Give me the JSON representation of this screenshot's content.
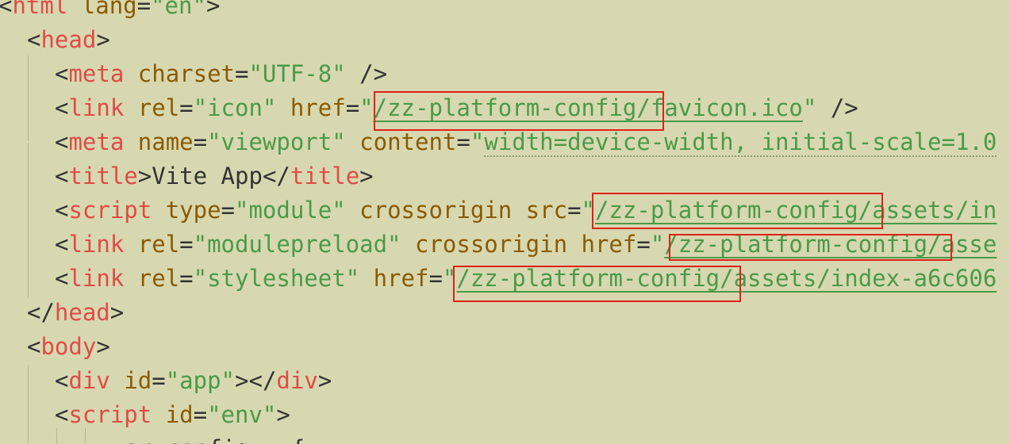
{
  "code": {
    "l0": {
      "lt": "<",
      "tag": "html",
      "a1": " lang",
      "eq": "=",
      "v1": "\"en\"",
      "gt": ">"
    },
    "l1": {
      "lt": "<",
      "tag": "head",
      "gt": ">"
    },
    "l2": {
      "lt": "<",
      "tag": "meta",
      "a1": " charset",
      "eq": "=",
      "v1": "\"UTF-8\"",
      "end": " />"
    },
    "l3": {
      "lt": "<",
      "tag": "link",
      "a1": " rel",
      "eq1": "=",
      "v1": "\"icon\"",
      "a2": " href",
      "eq2": "=",
      "q": "\"",
      "v2": "/zz-platform-config/favicon.ico",
      "q2": "\"",
      "end": " />"
    },
    "l4": {
      "lt": "<",
      "tag": "meta",
      "a1": " name",
      "eq1": "=",
      "v1": "\"viewport\"",
      "a2": " content",
      "eq2": "=",
      "q": "\"",
      "v2": "width=device-width, initial-scale=1.0"
    },
    "l5": {
      "lt": "<",
      "tag": "title",
      "gt": ">",
      "text": "Vite App",
      "clt": "</",
      "ctag": "title",
      "cgt": ">"
    },
    "l6": {
      "lt": "<",
      "tag": "script",
      "a1": " type",
      "eq1": "=",
      "v1": "\"module\"",
      "a2": " crossorigin",
      "a3": " src",
      "eq3": "=",
      "q": "\"",
      "v3": "/zz-platform-config/assets/in"
    },
    "l7": {
      "lt": "<",
      "tag": "link",
      "a1": " rel",
      "eq1": "=",
      "v1": "\"modulepreload\"",
      "a2": " crossorigin",
      "a3": " href",
      "eq3": "=",
      "q": "\"",
      "v3": "/zz-platform-config/asse"
    },
    "l8": {
      "lt": "<",
      "tag": "link",
      "a1": " rel",
      "eq1": "=",
      "v1": "\"stylesheet\"",
      "a2": " href",
      "eq2": "=",
      "q": "\"",
      "v2": "/zz-platform-config/assets/index-a6c606"
    },
    "l9": {
      "lt": "</",
      "tag": "head",
      "gt": ">"
    },
    "l10": {
      "lt": "<",
      "tag": "body",
      "gt": ">"
    },
    "l11": {
      "lt": "<",
      "tag": "div",
      "a1": " id",
      "eq": "=",
      "v1": "\"app\"",
      "gt": ">",
      "clt": "</",
      "ctag": "div",
      "cgt": ">"
    },
    "l12": {
      "lt": "<",
      "tag": "script",
      "a1": " id",
      "eq": "=",
      "v1": "\"env\"",
      "gt": ">"
    },
    "l13": {
      "text": "var config = {"
    }
  },
  "colors": {
    "background": "#d7d8b0",
    "tag": "#e04b48",
    "attribute": "#8b5a00",
    "string": "#4a9a4a",
    "highlight_box": "#e0211c"
  }
}
